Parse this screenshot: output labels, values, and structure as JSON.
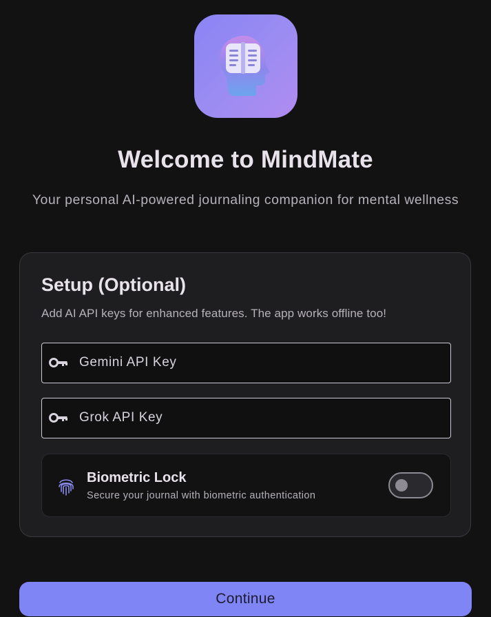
{
  "app": {
    "logo_icon": "brain-book-icon",
    "accent_color": "#8085f6"
  },
  "welcome": {
    "title": "Welcome to MindMate",
    "subtitle": "Your personal AI-powered journaling companion for mental wellness"
  },
  "setup": {
    "title": "Setup (Optional)",
    "description": "Add AI API keys for enhanced features. The app works offline too!",
    "fields": [
      {
        "label": "Gemini API Key",
        "value": "",
        "icon": "key-icon"
      },
      {
        "label": "Grok API Key",
        "value": "",
        "icon": "key-icon"
      }
    ],
    "biometric": {
      "title": "Biometric Lock",
      "description": "Secure your journal with biometric authentication",
      "icon": "fingerprint-icon",
      "enabled": false
    }
  },
  "actions": {
    "continue_label": "Continue"
  }
}
